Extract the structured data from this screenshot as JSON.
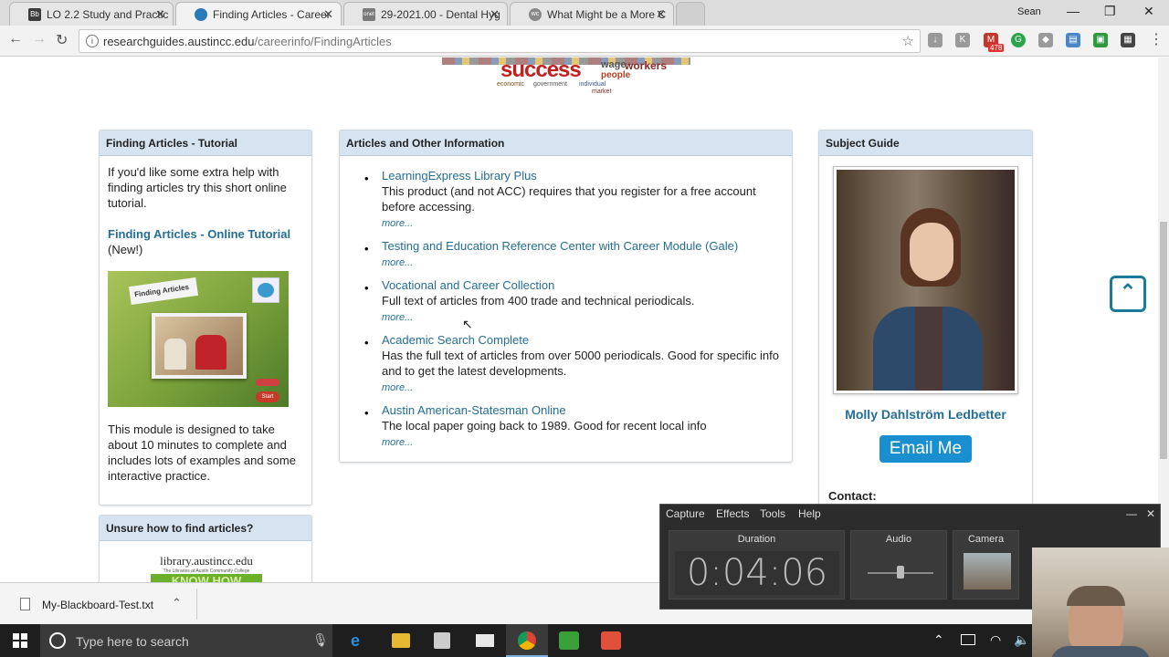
{
  "browser": {
    "tabs": [
      {
        "label": "LO 2.2 Study and Practic",
        "favicon": "Bb",
        "favicon_color": "#3b3b3b",
        "active": false
      },
      {
        "label": "Finding Articles - Career",
        "favicon": "",
        "favicon_color": "#2a7ab8",
        "active": true
      },
      {
        "label": "29-2021.00 - Dental Hyg",
        "favicon": "onet",
        "favicon_color": "#7a7a7a",
        "active": false
      },
      {
        "label": "What Might be a More C",
        "favicon": "wc",
        "favicon_color": "#888888",
        "active": false
      }
    ],
    "user_name": "Sean",
    "url_host": "researchguides.austincc.edu",
    "url_path": "/careerinfo/FindingArticles",
    "mail_badge": "478"
  },
  "page": {
    "cloud_word": "success",
    "cloud_words_small": [
      "wage",
      "workers",
      "people",
      "economic",
      "government",
      "individual",
      "market"
    ],
    "tutorial": {
      "heading": "Finding Articles - Tutorial",
      "intro": "If you'd like some extra help with finding articles try this short online tutorial.",
      "link": "Finding Articles - Online Tutorial",
      "new_tag": "(New!)",
      "image_card": "Finding Articles",
      "image_start": "Start",
      "description": "This module is designed to take about 10 minutes to complete and includes lots of examples and some interactive practice."
    },
    "unsure": {
      "heading": "Unsure how to find articles?",
      "logo_text": "library.austincc.edu",
      "logo_sub": "The Libraries at Austin Community College",
      "logo_know": "KNOW HOW"
    },
    "articles": {
      "heading": "Articles and Other Information",
      "more_label": "more...",
      "items": [
        {
          "title": "LearningExpress Library Plus",
          "desc": "This product (and not ACC) requires that you register for a free account before accessing."
        },
        {
          "title": "Testing and Education Reference Center with Career Module (Gale)",
          "desc": ""
        },
        {
          "title": "Vocational and Career Collection",
          "desc": "Full text of articles from 400 trade and technical periodicals."
        },
        {
          "title": "Academic Search Complete",
          "desc": "Has the full text of articles from over 5000 periodicals. Good for specific info and to get the latest developments."
        },
        {
          "title": "Austin American-Statesman Online",
          "desc": "The local paper going back to 1989. Good for recent local info"
        }
      ]
    },
    "subject_guide": {
      "heading": "Subject Guide",
      "name": "Molly Dahlström Ledbetter",
      "email_button": "Email Me",
      "contact_label": "Contact:"
    }
  },
  "download_bar": {
    "filename": "My-Blackboard-Test.txt"
  },
  "taskbar": {
    "search_placeholder": "Type here to search"
  },
  "recorder": {
    "menu": [
      "Capture",
      "Effects",
      "Tools",
      "Help"
    ],
    "duration_label": "Duration",
    "duration_value": "0:04:06",
    "audio_label": "Audio",
    "camera_label": "Camera"
  }
}
